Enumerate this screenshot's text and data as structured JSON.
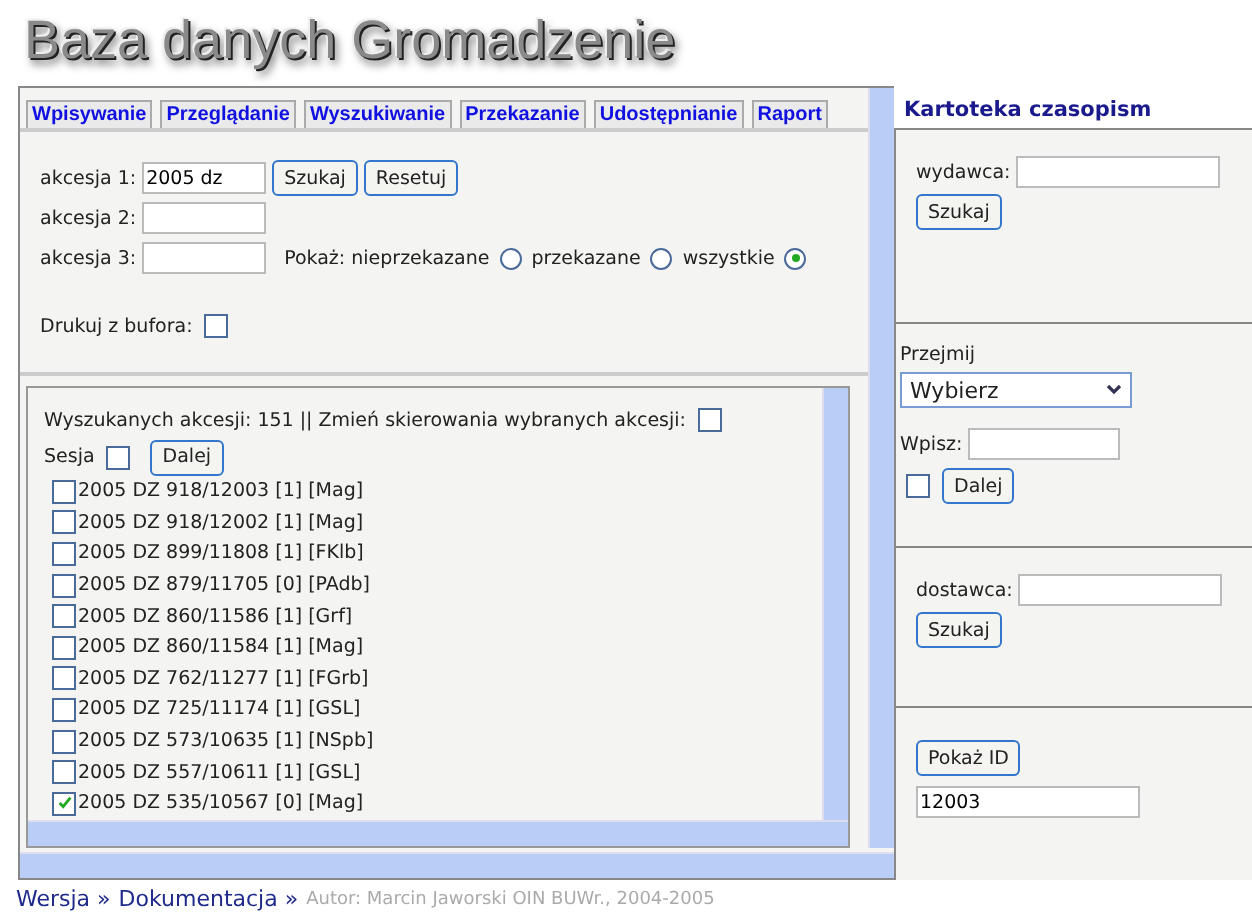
{
  "header": {
    "title": "Baza danych Gromadzenie"
  },
  "tabs": [
    {
      "label": "Wpisywanie"
    },
    {
      "label": "Przeglądanie"
    },
    {
      "label": "Wyszukiwanie"
    },
    {
      "label": "Przekazanie"
    },
    {
      "label": "Udostępnianie"
    },
    {
      "label": "Raport"
    }
  ],
  "search_form": {
    "fields": [
      {
        "label": "akcesja 1:",
        "value": "2005 dz"
      },
      {
        "label": "akcesja 2:"
      },
      {
        "label": "akcesja 3:"
      }
    ],
    "buttons": [
      "Szukaj",
      "Resetuj"
    ],
    "show_label": "Pokaż:",
    "show_options": [
      {
        "label": "nieprzekazane",
        "selected": false
      },
      {
        "label": "przekazane",
        "selected": false
      },
      {
        "label": "wszystkie",
        "selected": true
      }
    ],
    "print_label": "Drukuj z bufora:",
    "print_checked": false
  },
  "results": {
    "summary": "Wyszukanych akcesji: 151 || Zmień skierowania wybranych akcesji:",
    "change_checked": false,
    "session_label": "Sesja",
    "session_checked": false,
    "next_button": "Dalej",
    "items": [
      {
        "label": "2005 DZ 918/12003 [1] [Mag]",
        "checked": false
      },
      {
        "label": "2005 DZ 918/12002 [1] [Mag]",
        "checked": false
      },
      {
        "label": "2005 DZ 899/11808 [1] [FKlb]",
        "checked": false
      },
      {
        "label": "2005 DZ 879/11705 [0] [PAdb]",
        "checked": false
      },
      {
        "label": "2005 DZ 860/11586 [1] [Grf]",
        "checked": false
      },
      {
        "label": "2005 DZ 860/11584 [1] [Mag]",
        "checked": false
      },
      {
        "label": "2005 DZ 762/11277 [1] [FGrb]",
        "checked": false
      },
      {
        "label": "2005 DZ 725/11174 [1] [GSL]",
        "checked": false
      },
      {
        "label": "2005 DZ 573/10635 [1] [NSpb]",
        "checked": false
      },
      {
        "label": "2005 DZ 557/10611 [1] [GSL]",
        "checked": false
      },
      {
        "label": "2005 DZ 535/10567 [0] [Mag]",
        "checked": true
      }
    ]
  },
  "sidebar": {
    "title": "Kartoteka czasopism",
    "publisher": {
      "label": "wydawca:",
      "button": "Szukaj"
    },
    "transfer": {
      "label": "Przejmij",
      "select": "Wybierz",
      "input_label": "Wpisz:",
      "checked": false,
      "button": "Dalej"
    },
    "supplier": {
      "label": "dostawca:",
      "button": "Szukaj"
    },
    "id_panel": {
      "button": "Pokaż ID",
      "value": "12003"
    }
  },
  "footer": {
    "links": [
      "Wersja »",
      "Dokumentacja »"
    ],
    "credit": "Autor: Marcin Jaworski OIN BUWr., 2004-2005"
  }
}
